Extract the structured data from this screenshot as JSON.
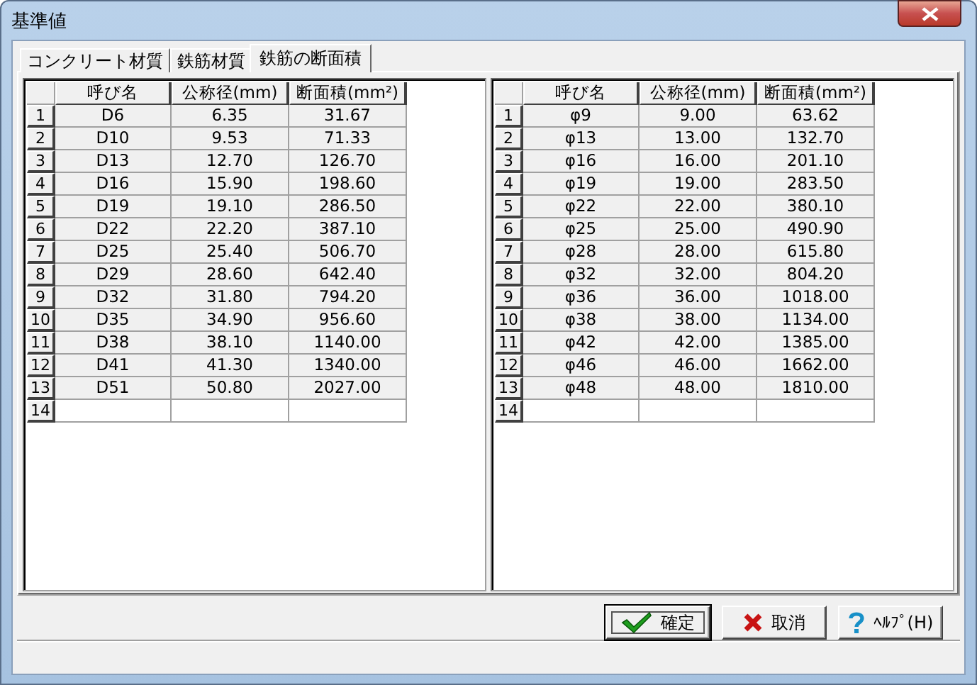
{
  "window": {
    "title": "基準値"
  },
  "tabs": [
    {
      "label": "コンクリート材質",
      "selected": false
    },
    {
      "label": "鉄筋材質",
      "selected": false
    },
    {
      "label": "鉄筋の断面積",
      "selected": true
    }
  ],
  "tables": [
    {
      "columns": [
        "呼び名",
        "公称径(mm)",
        "断面積(mm²)"
      ],
      "rows": [
        {
          "number": "1",
          "cells": [
            "D6",
            "6.35",
            "31.67"
          ]
        },
        {
          "number": "2",
          "cells": [
            "D10",
            "9.53",
            "71.33"
          ]
        },
        {
          "number": "3",
          "cells": [
            "D13",
            "12.70",
            "126.70"
          ]
        },
        {
          "number": "4",
          "cells": [
            "D16",
            "15.90",
            "198.60"
          ]
        },
        {
          "number": "5",
          "cells": [
            "D19",
            "19.10",
            "286.50"
          ]
        },
        {
          "number": "6",
          "cells": [
            "D22",
            "22.20",
            "387.10"
          ]
        },
        {
          "number": "7",
          "cells": [
            "D25",
            "25.40",
            "506.70"
          ]
        },
        {
          "number": "8",
          "cells": [
            "D29",
            "28.60",
            "642.40"
          ]
        },
        {
          "number": "9",
          "cells": [
            "D32",
            "31.80",
            "794.20"
          ]
        },
        {
          "number": "10",
          "cells": [
            "D35",
            "34.90",
            "956.60"
          ]
        },
        {
          "number": "11",
          "cells": [
            "D38",
            "38.10",
            "1140.00"
          ]
        },
        {
          "number": "12",
          "cells": [
            "D41",
            "41.30",
            "1340.00"
          ]
        },
        {
          "number": "13",
          "cells": [
            "D51",
            "50.80",
            "2027.00"
          ]
        },
        {
          "number": "14"
        }
      ]
    },
    {
      "columns": [
        "呼び名",
        "公称径(mm)",
        "断面積(mm²)"
      ],
      "rows": [
        {
          "number": "1",
          "cells": [
            "φ9",
            "9.00",
            "63.62"
          ]
        },
        {
          "number": "2",
          "cells": [
            "φ13",
            "13.00",
            "132.70"
          ]
        },
        {
          "number": "3",
          "cells": [
            "φ16",
            "16.00",
            "201.10"
          ]
        },
        {
          "number": "4",
          "cells": [
            "φ19",
            "19.00",
            "283.50"
          ]
        },
        {
          "number": "5",
          "cells": [
            "φ22",
            "22.00",
            "380.10"
          ]
        },
        {
          "number": "6",
          "cells": [
            "φ25",
            "25.00",
            "490.90"
          ]
        },
        {
          "number": "7",
          "cells": [
            "φ28",
            "28.00",
            "615.80"
          ]
        },
        {
          "number": "8",
          "cells": [
            "φ32",
            "32.00",
            "804.20"
          ]
        },
        {
          "number": "9",
          "cells": [
            "φ36",
            "36.00",
            "1018.00"
          ]
        },
        {
          "number": "10",
          "cells": [
            "φ38",
            "38.00",
            "1134.00"
          ]
        },
        {
          "number": "11",
          "cells": [
            "φ42",
            "42.00",
            "1385.00"
          ]
        },
        {
          "number": "12",
          "cells": [
            "φ46",
            "46.00",
            "1662.00"
          ]
        },
        {
          "number": "13",
          "cells": [
            "φ48",
            "48.00",
            "1810.00"
          ]
        },
        {
          "number": "14"
        }
      ]
    }
  ],
  "buttons": [
    {
      "kind": "ok",
      "label": "確定",
      "focused": true
    },
    {
      "kind": "cancel",
      "label": "取消",
      "focused": false
    },
    {
      "kind": "help",
      "label": "ﾍﾙﾌﾟ(H)",
      "focused": false
    }
  ]
}
